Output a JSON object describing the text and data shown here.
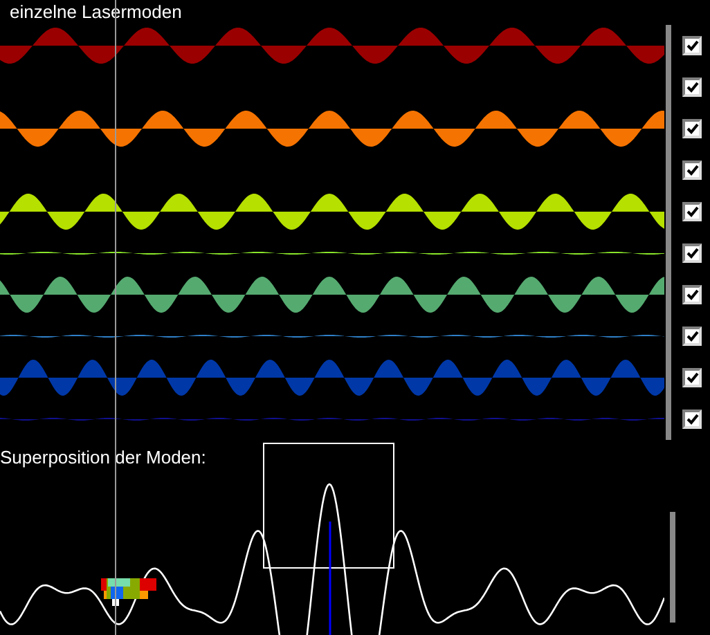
{
  "title": "einzelne Lasermoden",
  "modes": [
    {
      "kind": "wave",
      "color": "#9b0000",
      "checked": true
    },
    {
      "kind": "empty",
      "checked": true
    },
    {
      "kind": "wave",
      "color": "#f57300",
      "checked": true
    },
    {
      "kind": "empty",
      "checked": true
    },
    {
      "kind": "wave",
      "color": "#b5e000",
      "checked": true
    },
    {
      "kind": "faint",
      "color": "#8ae62a",
      "checked": true
    },
    {
      "kind": "wave",
      "color": "#55aa70",
      "checked": true
    },
    {
      "kind": "faint",
      "color": "#2f80c8",
      "checked": true
    },
    {
      "kind": "wave",
      "color": "#0038a8",
      "checked": true
    },
    {
      "kind": "faint",
      "color": "#101090",
      "checked": true
    }
  ],
  "superposition": {
    "label": "Superposition der Moden:"
  }
}
